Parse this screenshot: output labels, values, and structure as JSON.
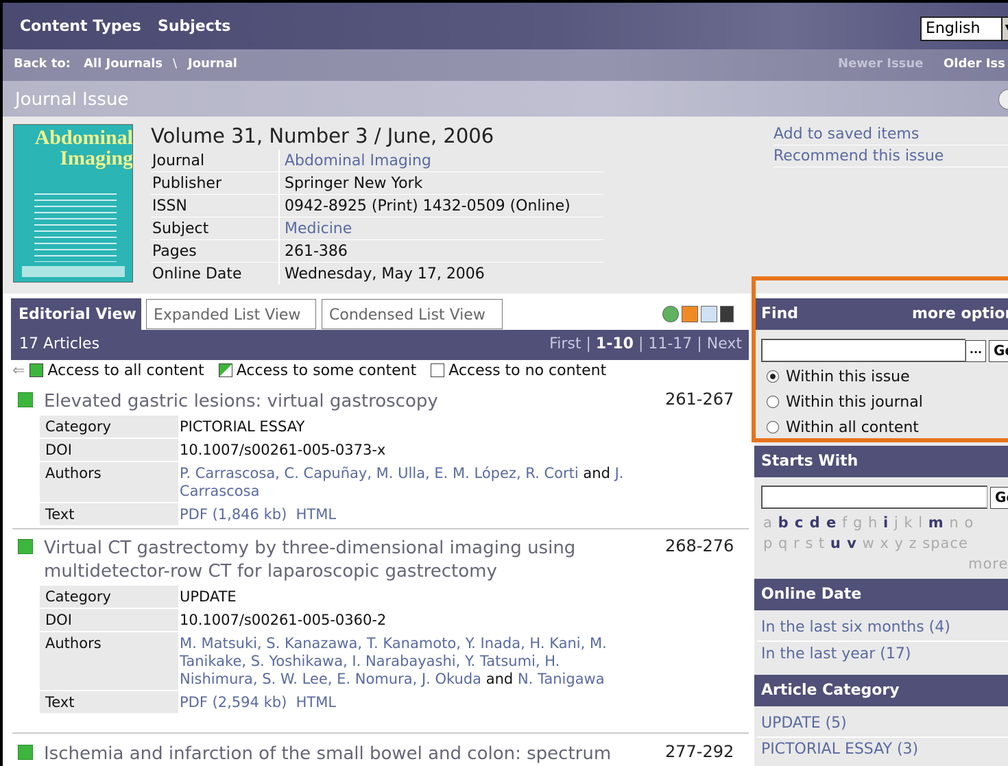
{
  "topnav": {
    "content_types": "Content Types",
    "subjects": "Subjects",
    "language": "English"
  },
  "backbar": {
    "back_to": "Back to:",
    "all_journals": "All Journals",
    "sep": "\\",
    "journal": "Journal",
    "newer": "Newer Issue",
    "older": "Older Iss"
  },
  "page_title": "Journal Issue",
  "cover": {
    "title_line1": "Abdominal",
    "title_line2": "Imaging"
  },
  "issue": {
    "heading": "Volume 31, Number 3 / June, 2006",
    "fields": [
      {
        "label": "Journal",
        "value": "Abdominal Imaging"
      },
      {
        "label": "Publisher",
        "value": "Springer New York"
      },
      {
        "label": "ISSN",
        "value": "0942-8925 (Print) 1432-0509 (Online)"
      },
      {
        "label": "Subject",
        "value": "Medicine"
      },
      {
        "label": "Pages",
        "value": "261-386"
      },
      {
        "label": "Online Date",
        "value": "Wednesday, May 17, 2006"
      }
    ]
  },
  "actions": {
    "save": "Add to saved items",
    "recommend": "Recommend this issue"
  },
  "tabs": {
    "editorial": "Editorial View",
    "expanded": "Expanded List View",
    "condensed": "Condensed List View"
  },
  "articles_bar": {
    "count": "17 Articles",
    "first": "First",
    "sep": "|",
    "range1": "1-10",
    "range2": "11-17",
    "next": "Next"
  },
  "legend": {
    "all": "Access to all content",
    "some": "Access to some content",
    "none": "Access to no content"
  },
  "labels": {
    "category": "Category",
    "doi": "DOI",
    "authors": "Authors",
    "text": "Text"
  },
  "articles": [
    {
      "title": "Elevated gastric lesions: virtual gastroscopy",
      "pages": "261-267",
      "category": "PICTORIAL ESSAY",
      "doi": "10.1007/s00261-005-0373-x",
      "authors_a": "P. Carrascosa, C. Capuñay, M. Ulla, E. M. López, R. Corti",
      "and": "and",
      "authors_b": "J. Carrascosa",
      "pdf": "PDF (1,846 kb)",
      "html": "HTML"
    },
    {
      "title": "Virtual CT gastrectomy by three-dimensional imaging using multidetector-row CT for laparoscopic gastrectomy",
      "pages": "268-276",
      "category": "UPDATE",
      "doi": "10.1007/s00261-005-0360-2",
      "authors_a": "M. Matsuki, S. Kanazawa, T. Kanamoto, Y. Inada, H. Kani, M. Tanikake, S. Yoshikawa, I. Narabayashi, Y. Tatsumi, H. Nishimura, S. W. Lee, E. Nomura, J. Okuda",
      "and": "and",
      "authors_b": "N. Tanigawa",
      "pdf": "PDF (2,594 kb)",
      "html": "HTML"
    },
    {
      "title": "Ischemia and infarction of the small bowel and colon: spectrum",
      "pages": "277-292"
    }
  ],
  "find": {
    "heading": "Find",
    "more": "more option",
    "dots": "...",
    "go": "Go",
    "options": [
      "Within this issue",
      "Within this journal",
      "Within all content"
    ]
  },
  "starts_with": {
    "heading": "Starts With",
    "go": "Go",
    "row1_a": "a",
    "row1_b": "b c d e",
    "row1_c": "f g h",
    "row1_d": "i",
    "row1_e": "j k l",
    "row1_f": "m",
    "row1_g": "n o",
    "row2_a": "p q r s t",
    "row2_b": "u v",
    "row2_c": "w x y z space",
    "more": "more"
  },
  "online_date": {
    "heading": "Online Date",
    "six_months": "In the last six months (4)",
    "year": "In the last year (17)"
  },
  "article_category": {
    "heading": "Article Category",
    "update": "UPDATE (5)",
    "pictorial": "PICTORIAL ESSAY (3)"
  }
}
